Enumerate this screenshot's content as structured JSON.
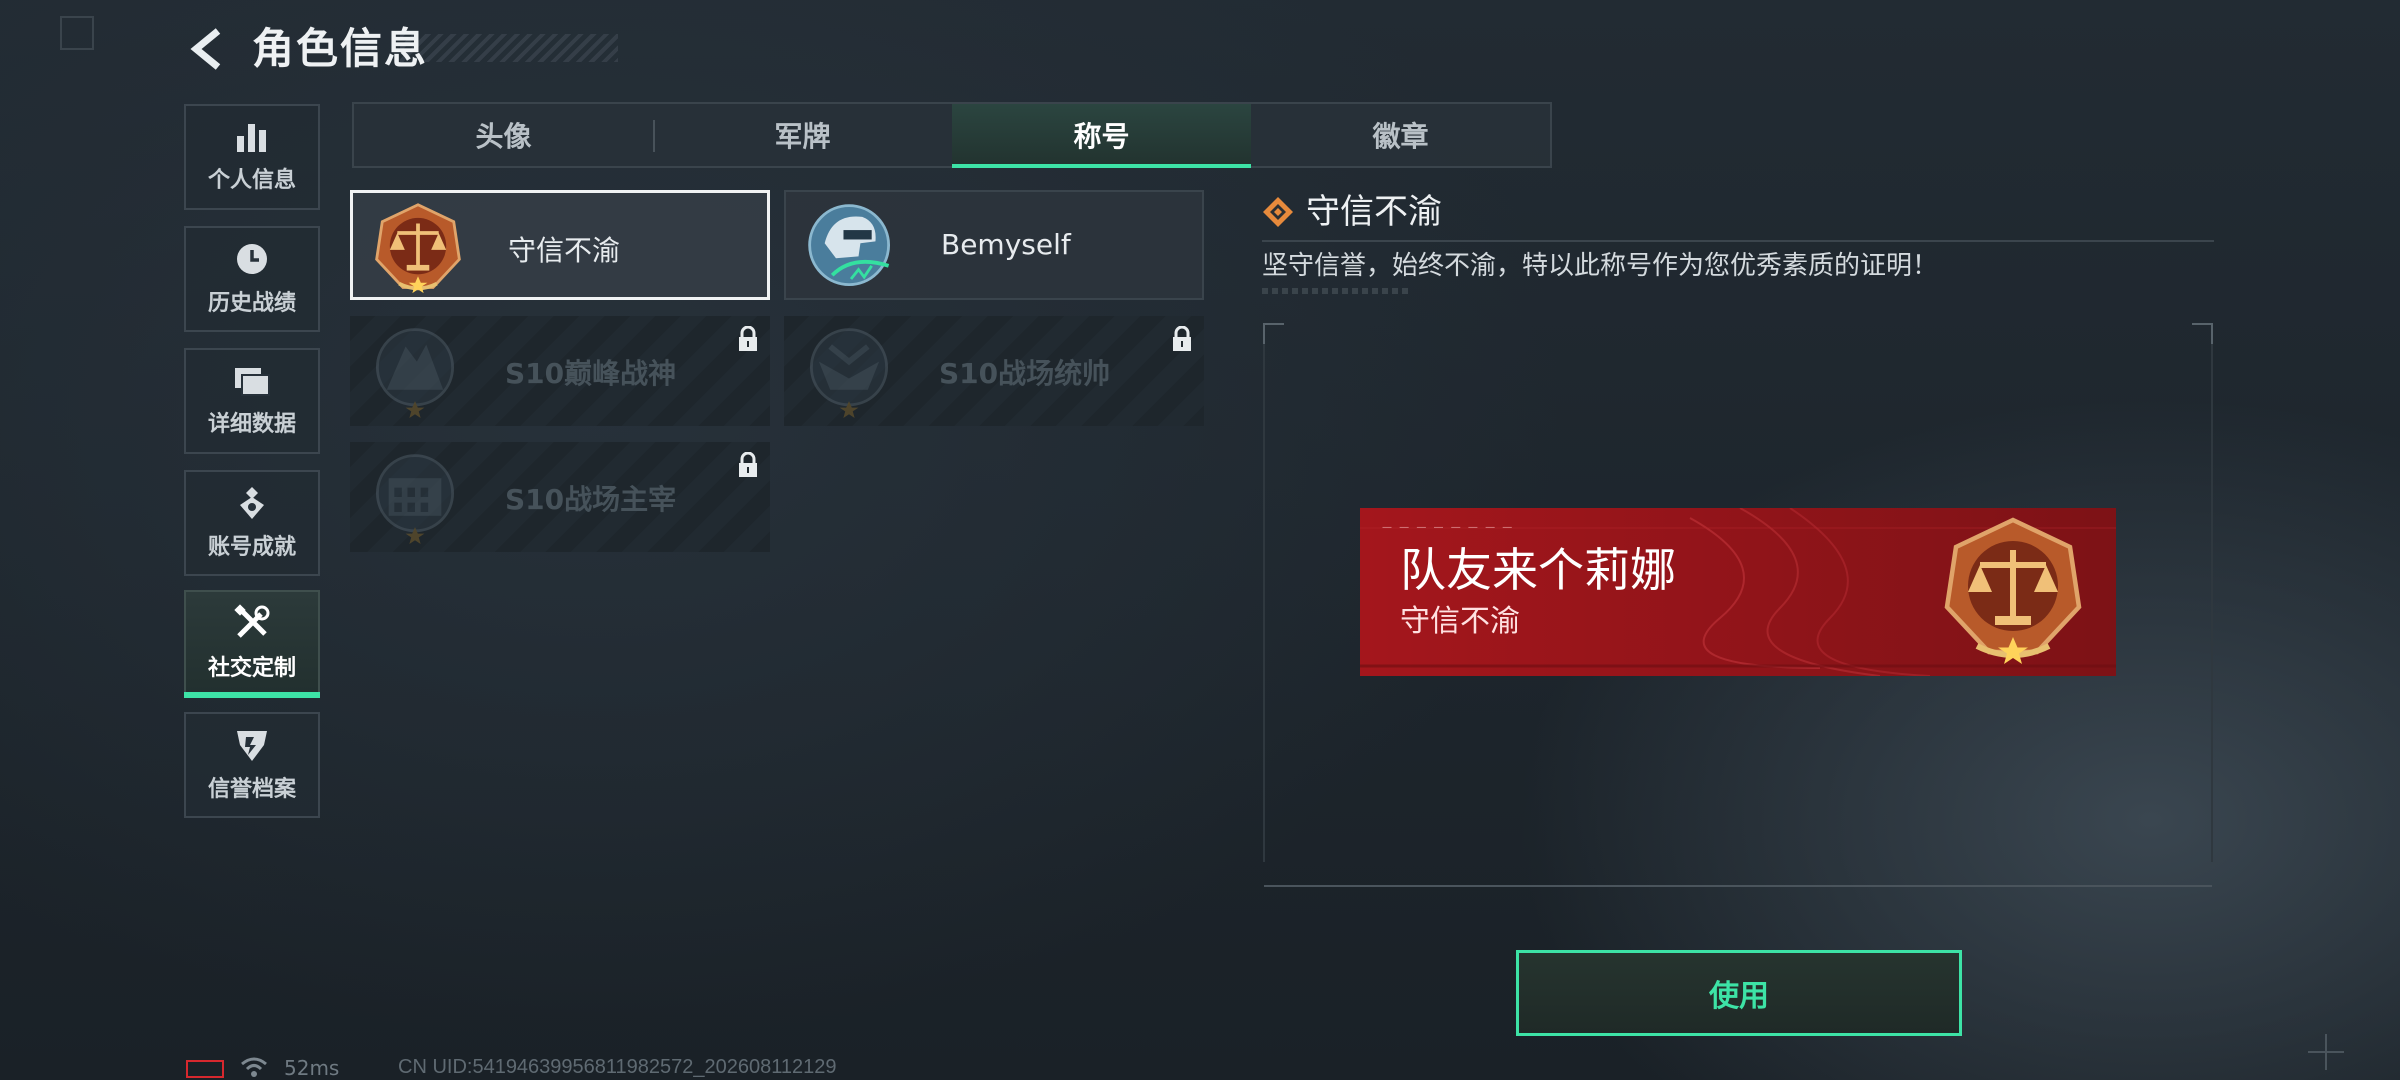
{
  "header": {
    "title": "角色信息",
    "back_icon": "chevron-left-icon"
  },
  "sidebar": {
    "items": [
      {
        "label": "个人信息",
        "icon": "bar-chart-icon",
        "active": false
      },
      {
        "label": "历史战绩",
        "icon": "clock-icon",
        "active": false
      },
      {
        "label": "详细数据",
        "icon": "folder-icon",
        "active": false
      },
      {
        "label": "账号成就",
        "icon": "achievement-icon",
        "active": false
      },
      {
        "label": "社交定制",
        "icon": "tools-icon",
        "active": true
      },
      {
        "label": "信誉档案",
        "icon": "credit-shield-icon",
        "active": false
      }
    ]
  },
  "tabs": [
    {
      "label": "头像",
      "active": false
    },
    {
      "label": "军牌",
      "active": false
    },
    {
      "label": "称号",
      "active": true
    },
    {
      "label": "徽章",
      "active": false
    }
  ],
  "titles": [
    {
      "name": "守信不渝",
      "locked": false,
      "selected": true,
      "icon": "scales-emblem-icon"
    },
    {
      "name": "Bemyself",
      "locked": false,
      "selected": false,
      "icon": "soldier-emblem-icon"
    },
    {
      "name": "S10巅峰战神",
      "locked": true,
      "selected": false,
      "icon": "peak-emblem-icon"
    },
    {
      "name": "S10战场统帅",
      "locked": true,
      "selected": false,
      "icon": "commander-emblem-icon"
    },
    {
      "name": "S10战场主宰",
      "locked": true,
      "selected": false,
      "icon": "colosseum-emblem-icon"
    }
  ],
  "detail": {
    "name": "守信不渝",
    "description": "坚守信誉，始终不渝，特以此称号作为您优秀素质的证明！",
    "preview": {
      "player_name": "队友来个莉娜",
      "title": "守信不渝"
    },
    "use_label": "使用"
  },
  "footer": {
    "ping": "52ms",
    "uid": "CN UID:54194639956811982572_202608112129"
  },
  "colors": {
    "accent": "#3de3a6",
    "banner_red": "#a4161c",
    "emblem_bronze": "#b85a2a",
    "detail_icon": "#e68a3c"
  }
}
